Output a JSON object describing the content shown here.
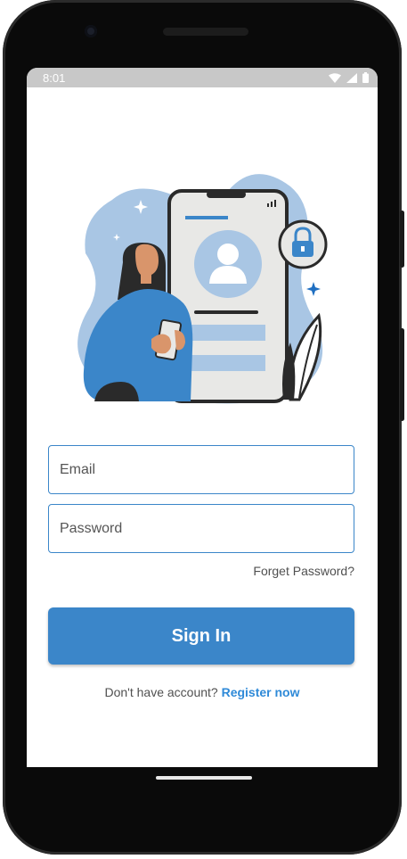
{
  "status_bar": {
    "time": "8:01",
    "icons": [
      "wifi-icon",
      "signal-icon",
      "battery-icon"
    ]
  },
  "illustration": {
    "icons": [
      "lock-icon",
      "user-avatar-icon",
      "sparkle-icon"
    ]
  },
  "form": {
    "email": {
      "value": "",
      "placeholder": "Email"
    },
    "password": {
      "value": "",
      "placeholder": "Password"
    },
    "forget_label": "Forget Password?",
    "signin_label": "Sign In",
    "register_prompt": "Don't have account?",
    "register_link": "Register now"
  },
  "colors": {
    "accent": "#3b86c9",
    "link": "#2f8ad8",
    "illustration_blob": "#a9c6e4",
    "status_bar": "#c8c8c8"
  }
}
